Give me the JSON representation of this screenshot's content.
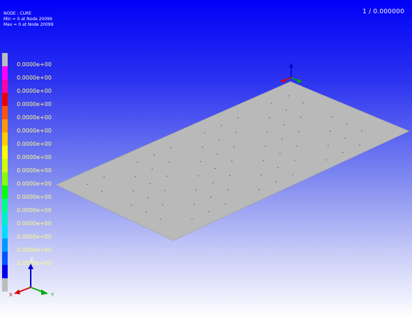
{
  "viewport": {
    "info": {
      "line1": "NODE : CURE",
      "line2": "Min = 0  at Node  20099",
      "line3": "Max = 0  at Node  20099"
    },
    "frame_label": "1 / 0.000000",
    "legend": {
      "colors": [
        "#bcbcbc",
        "#ff00ff",
        "#ff00aa",
        "#ee0000",
        "#ff5500",
        "#ff9900",
        "#ffcc00",
        "#ffff00",
        "#ccff00",
        "#88ff00",
        "#00ff00",
        "#00ff88",
        "#00eecc",
        "#00ddff",
        "#0099ff",
        "#0055ff",
        "#0000ee",
        "#bcbcbc"
      ],
      "labels": [
        "0.0000e+00",
        "0.0000e+00",
        "0.0000e+00",
        "0.0000e+00",
        "0.0000e+00",
        "0.0000e+00",
        "0.0000e+00",
        "0.0000e+00",
        "0.0000e+00",
        "0.0000e+00",
        "0.0000e+00",
        "0.0000e+00",
        "0.0000e+00",
        "0.0000e+00",
        "0.0000e+00",
        "0.0000e+00"
      ]
    },
    "global_axes": {
      "x": "X",
      "y": "Y",
      "z": "Z"
    },
    "mesh_color": "#b9b9b9"
  }
}
